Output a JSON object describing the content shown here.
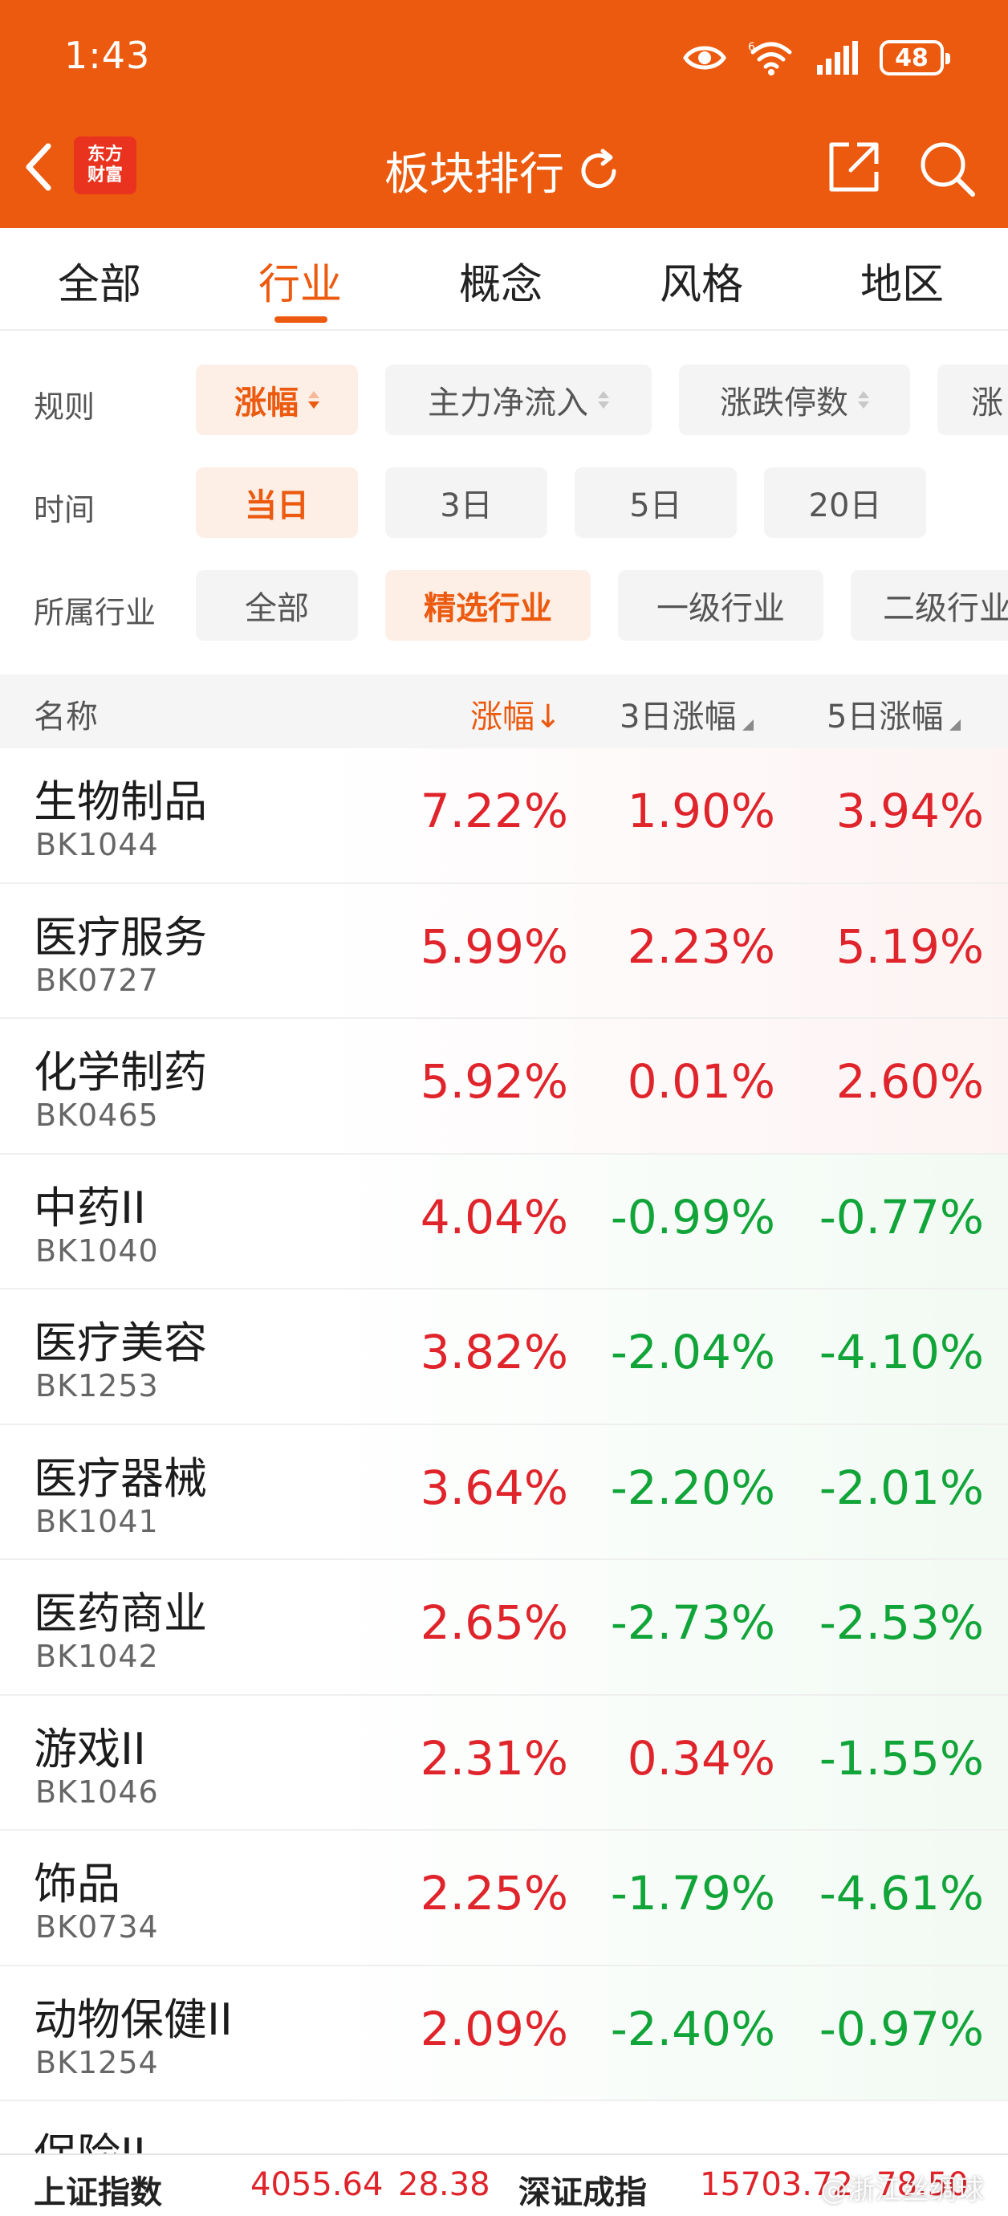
{
  "status_bar": {
    "time": "1:43",
    "battery": "48",
    "icons": [
      "eye-icon",
      "wifi-icon",
      "signal-icon",
      "battery-icon"
    ]
  },
  "nav": {
    "logo_line1": "东方",
    "logo_line2": "财富",
    "title": "板块排行",
    "icons": [
      "back-icon",
      "refresh-icon",
      "share-icon",
      "search-icon"
    ]
  },
  "tabs": [
    {
      "label": "全部",
      "active": false
    },
    {
      "label": "行业",
      "active": true
    },
    {
      "label": "概念",
      "active": false
    },
    {
      "label": "风格",
      "active": false
    },
    {
      "label": "地区",
      "active": false
    }
  ],
  "filters": {
    "rule": {
      "label": "规则",
      "options": [
        "涨幅",
        "主力净流入",
        "涨跌停数",
        "涨"
      ],
      "active_index": 0
    },
    "time": {
      "label": "时间",
      "options": [
        "当日",
        "3日",
        "5日",
        "20日"
      ],
      "active_index": 0
    },
    "industry": {
      "label": "所属行业",
      "options": [
        "全部",
        "精选行业",
        "一级行业",
        "二级行业"
      ],
      "active_index": 1
    }
  },
  "table": {
    "headers": {
      "name": "名称",
      "change": "涨幅↓",
      "change_3d": "3日涨幅",
      "change_5d": "5日涨幅"
    },
    "rows": [
      {
        "name": "生物制品",
        "code": "BK1044",
        "change": "7.22%",
        "change_3d": "1.90%",
        "change_5d": "3.94%"
      },
      {
        "name": "医疗服务",
        "code": "BK0727",
        "change": "5.99%",
        "change_3d": "2.23%",
        "change_5d": "5.19%"
      },
      {
        "name": "化学制药",
        "code": "BK0465",
        "change": "5.92%",
        "change_3d": "0.01%",
        "change_5d": "2.60%"
      },
      {
        "name": "中药II",
        "code": "BK1040",
        "change": "4.04%",
        "change_3d": "-0.99%",
        "change_5d": "-0.77%"
      },
      {
        "name": "医疗美容",
        "code": "BK1253",
        "change": "3.82%",
        "change_3d": "-2.04%",
        "change_5d": "-4.10%"
      },
      {
        "name": "医疗器械",
        "code": "BK1041",
        "change": "3.64%",
        "change_3d": "-2.20%",
        "change_5d": "-2.01%"
      },
      {
        "name": "医药商业",
        "code": "BK1042",
        "change": "2.65%",
        "change_3d": "-2.73%",
        "change_5d": "-2.53%"
      },
      {
        "name": "游戏II",
        "code": "BK1046",
        "change": "2.31%",
        "change_3d": "0.34%",
        "change_5d": "-1.55%"
      },
      {
        "name": "饰品",
        "code": "BK0734",
        "change": "2.25%",
        "change_3d": "-1.79%",
        "change_5d": "-4.61%"
      },
      {
        "name": "动物保健II",
        "code": "BK1254",
        "change": "2.09%",
        "change_3d": "-2.40%",
        "change_5d": "-0.97%"
      }
    ],
    "partial_row_name": "保险II"
  },
  "ticker": {
    "index1_name": "上证指数",
    "index1_value": "4055.64",
    "index1_change": "28.38",
    "index2_name": "深证成指",
    "index2_value": "15703.72",
    "index2_change": "78.50"
  },
  "watermark": "@浙江丝绸球",
  "colors": {
    "brand": "#ec5a0f",
    "up": "#e0242b",
    "down": "#11a438"
  }
}
